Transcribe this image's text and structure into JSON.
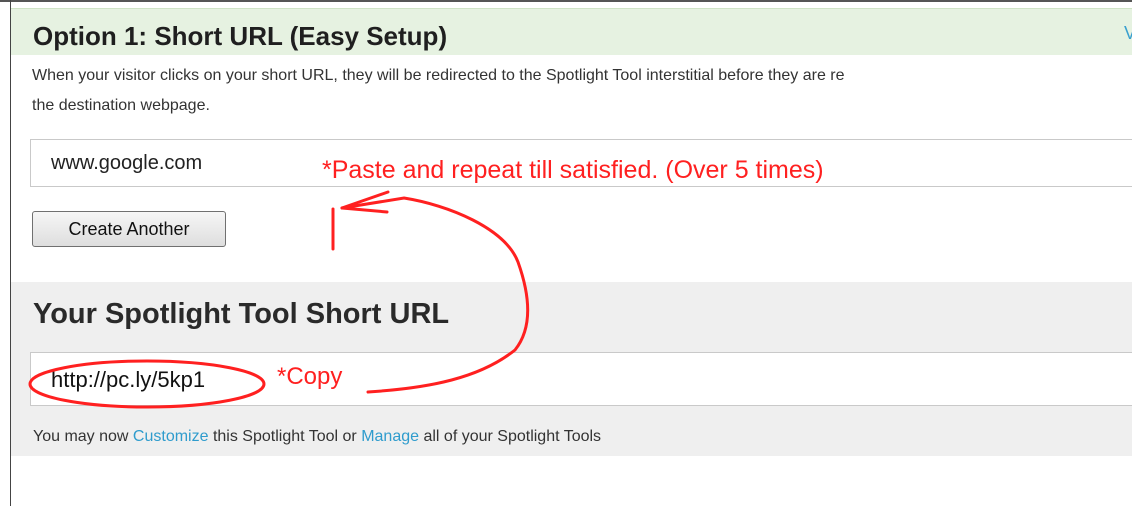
{
  "header": {
    "title": "Option 1: Short URL (Easy Setup)",
    "link_label": "Vi"
  },
  "description": {
    "line1": "When your visitor clicks on your short URL, they will be redirected to the Spotlight Tool interstitial before they are re",
    "line2": "the destination webpage."
  },
  "url_input": {
    "value": "www.google.com"
  },
  "create_button": {
    "label": "Create Another"
  },
  "result": {
    "title": "Your Spotlight Tool Short URL",
    "short_url": "http://pc.ly/5kp1"
  },
  "footer": {
    "before": "You may now ",
    "customize_link": "Customize",
    "middle": " this Spotlight Tool or ",
    "manage_link": "Manage",
    "after": " all of your Spotlight Tools"
  },
  "annotations": {
    "paste_note": "*Paste and repeat till satisfied. (Over 5 times)",
    "copy_note": "*Copy",
    "color": "#ff2020"
  },
  "colors": {
    "header_bg": "#e6f2e1",
    "link": "#2f9ccd",
    "panel_bg": "#efefef"
  }
}
